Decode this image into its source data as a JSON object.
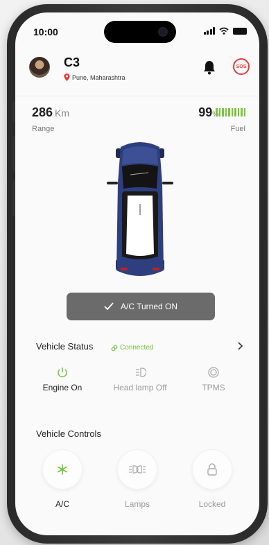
{
  "status_bar": {
    "time": "10:00"
  },
  "user": {
    "name": "C3",
    "location": "Pune, Maharashtra"
  },
  "header": {
    "sos_label": "SOS"
  },
  "range": {
    "value": "286",
    "unit": "Km",
    "label": "Range"
  },
  "fuel": {
    "value": "99",
    "unit": "%",
    "label": "Fuel",
    "bars_filled": 10,
    "bars_total": 10
  },
  "toast": {
    "message": "A/C Turned ON"
  },
  "vehicle_status": {
    "title": "Vehicle Status",
    "connection": "Connected",
    "items": [
      {
        "label": "Engine On",
        "icon": "power-icon",
        "active": true
      },
      {
        "label": "Head lamp Off",
        "icon": "headlamp-icon",
        "active": false
      },
      {
        "label": "TPMS",
        "icon": "tire-icon",
        "active": false
      }
    ]
  },
  "vehicle_controls": {
    "title": "Vehicle Controls",
    "items": [
      {
        "label": "A/C",
        "icon": "snowflake-icon",
        "active": true
      },
      {
        "label": "Lamps",
        "icon": "lamps-icon",
        "active": false
      },
      {
        "label": "Locked",
        "icon": "lock-icon",
        "active": false
      }
    ]
  },
  "colors": {
    "accent_green": "#6fc23a",
    "sos_red": "#e53935",
    "car_blue": "#2e3f7f",
    "toast_bg": "#6b6b6b"
  }
}
